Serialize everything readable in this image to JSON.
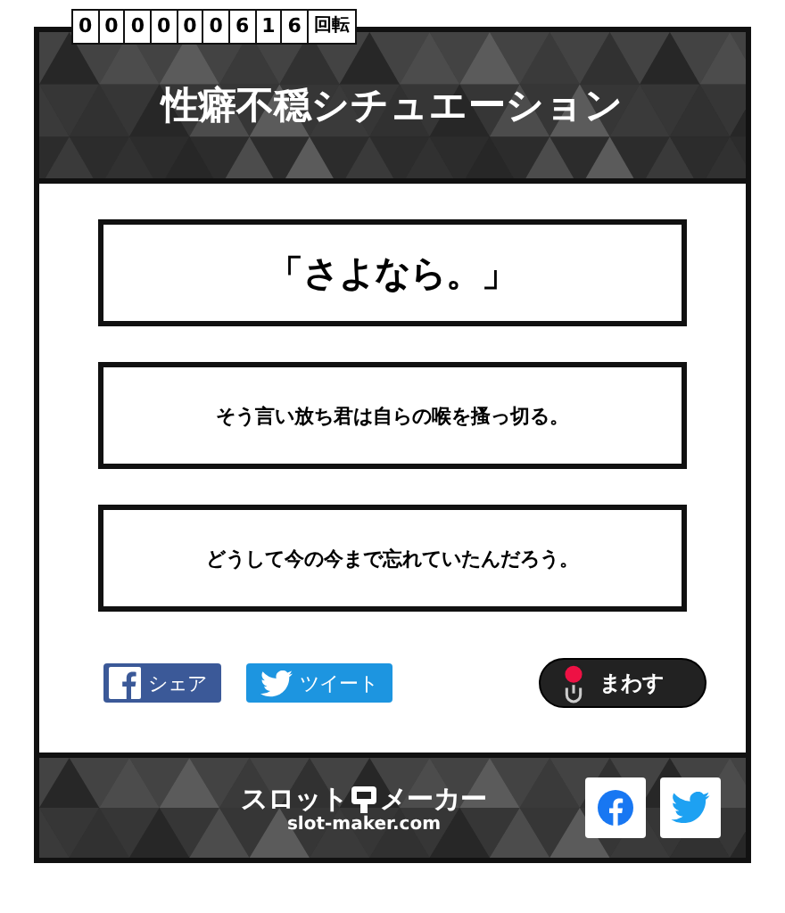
{
  "counter": {
    "digits": [
      "0",
      "0",
      "0",
      "0",
      "0",
      "0",
      "6",
      "1",
      "6"
    ],
    "unit": "回転"
  },
  "header": {
    "title": "性癖不穏シチュエーション"
  },
  "results": [
    {
      "text": "「さよなら。」",
      "kind": "main"
    },
    {
      "text": "そう言い放ち君は自らの喉を搔っ切る。",
      "kind": "sub"
    },
    {
      "text": "どうして今の今まで忘れていたんだろう。",
      "kind": "sub"
    }
  ],
  "share_buttons": [
    {
      "label": "シェア",
      "kind": "facebook"
    },
    {
      "label": "ツイート",
      "kind": "twitter"
    }
  ],
  "spin_button": {
    "label": "まわす"
  },
  "footer": {
    "logo": "スロット",
    "logo_tail": "メーカー",
    "domain": "slot-maker.com",
    "social": [
      {
        "kind": "facebook"
      },
      {
        "kind": "twitter"
      }
    ]
  }
}
